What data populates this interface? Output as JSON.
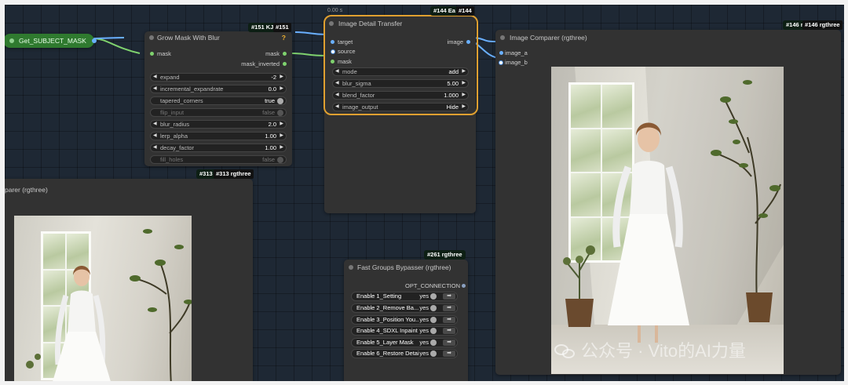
{
  "canvas": {
    "top_label": "0.00 s"
  },
  "get_subject_mask": {
    "label": "Get_SUBJECT_MASK"
  },
  "grow_mask": {
    "badge": "#151 KJ",
    "badge_hover": "#151",
    "title": "Grow Mask With Blur",
    "warn": "?",
    "input_mask": "mask",
    "output_mask": "mask",
    "output_mask_inverted": "mask_inverted",
    "widgets": [
      {
        "label": "expand",
        "value": "-2"
      },
      {
        "label": "incremental_expandrate",
        "value": "0.0"
      },
      {
        "label": "tapered_corners",
        "value": "true"
      },
      {
        "label": "flip_input",
        "value": "false"
      },
      {
        "label": "blur_radius",
        "value": "2.0"
      },
      {
        "label": "lerp_alpha",
        "value": "1.00"
      },
      {
        "label": "decay_factor",
        "value": "1.00"
      },
      {
        "label": "fill_holes",
        "value": "false"
      }
    ]
  },
  "image_detail_transfer": {
    "badge": "#144 Ea",
    "badge_hover": "#144",
    "title": "Image Detail Transfer",
    "input_target": "target",
    "input_source": "source",
    "input_mask": "mask",
    "output_image": "image",
    "widgets": [
      {
        "label": "mode",
        "value": "add"
      },
      {
        "label": "blur_sigma",
        "value": "5.00"
      },
      {
        "label": "blend_factor",
        "value": "1.000"
      },
      {
        "label": "image_output",
        "value": "Hide"
      }
    ],
    "highlight_color": "#e0a030"
  },
  "image_comparer_right": {
    "badge": "#146 r",
    "badge_hover": "#146 rgthree",
    "title": "Image Comparer (rgthree)",
    "input_a": "image_a",
    "input_b": "image_b"
  },
  "image_comparer_left": {
    "badge": "#313 r",
    "badge_hover": "#313 rgthree",
    "title": "parer (rgthree)"
  },
  "fast_groups": {
    "badge": "#261 rgthree",
    "title": "Fast Groups Bypasser (rgthree)",
    "output": "OPT_CONNECTION",
    "rows": [
      {
        "label": "Enable 1_Setting",
        "value": "yes"
      },
      {
        "label": "Enable 2_Remove Ba...",
        "value": "yes"
      },
      {
        "label": "Enable 3_Position You...",
        "value": "yes"
      },
      {
        "label": "Enable 4_SDXL Inpaint",
        "value": "yes"
      },
      {
        "label": "Enable 5_Layer Mask",
        "value": "yes"
      },
      {
        "label": "Enable 6_Restore Detail",
        "value": "yes"
      }
    ]
  },
  "watermark": "公众号 · Vito的AI力量",
  "colors": {
    "canvas_bg": "#1e2834",
    "node_bg": "#323232",
    "wire_green": "#7fd26e",
    "wire_blue": "#6ab0ff",
    "get_node_green": "#2f7a2f"
  }
}
